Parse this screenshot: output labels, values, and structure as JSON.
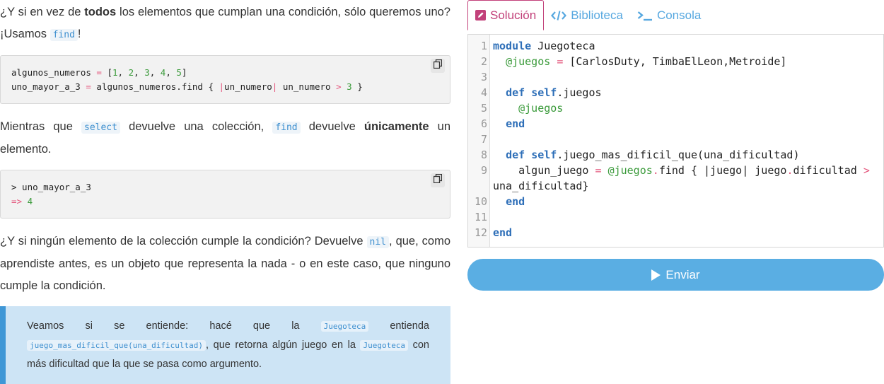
{
  "intro": {
    "p1_a": "¿Y si en vez de ",
    "p1_bold": "todos",
    "p1_b": " los elementos que cumplan una condición, sólo queremos uno? ¡Usamos ",
    "p1_code": "find",
    "p1_c": "!"
  },
  "code1": {
    "l1_a": "algunos_numeros ",
    "l1_eq": "=",
    "l1_b": " [",
    "l1_n1": "1",
    "l1_n2": "2",
    "l1_n3": "3",
    "l1_n4": "4",
    "l1_n5": "5",
    "l1_c": "]",
    "l2_a": "uno_mayor_a_3 ",
    "l2_eq": "=",
    "l2_b": " algunos_numeros.find { ",
    "l2_p1": "|",
    "l2_c": "un_numero",
    "l2_p2": "|",
    "l2_d": " un_numero ",
    "l2_gt": ">",
    "l2_n": "3",
    "l2_e": " }"
  },
  "para2": {
    "a": "Mientras que ",
    "code1": "select",
    "b": " devuelve una colección, ",
    "code2": "find",
    "c": " devuelve ",
    "bold": "únicamente",
    "d": " un elemento."
  },
  "code2": {
    "l1": "> uno_mayor_a_3",
    "l2_arrow": "=>",
    "l2_val": "4"
  },
  "para3": {
    "a": "¿Y si ningún elemento de la colección cumple la condición? Devuelve ",
    "code": "nil",
    "b": ", que, como aprendiste antes, es un objeto que representa la nada - o en este caso, que ninguno cumple la condición."
  },
  "callout": {
    "a": "Veamos si se entiende: hacé que la ",
    "code1": "Juegoteca",
    "b": " entienda ",
    "code2": "juego_mas_dificil_que(una_dificultad)",
    "c": ", que retorna algún juego en la ",
    "code3": "Juegoteca",
    "d": " con más dificultad que la que se pasa como argumento."
  },
  "tabs": {
    "solucion": "Solución",
    "biblioteca": "Biblioteca",
    "consola": "Consola"
  },
  "editor": {
    "ln": [
      "1",
      "2",
      "3",
      "4",
      "5",
      "6",
      "7",
      "8",
      "9",
      "",
      "10",
      "11",
      "12"
    ],
    "l1_kw": "module",
    "l1_rest": " Juegoteca",
    "l2_iv": "@juegos",
    "l2_eq": "=",
    "l2_rest": " [CarlosDuty, TimbaElLeon,Metroide]",
    "l4_kw1": "def",
    "l4_kw2": "self",
    "l4_rest": ".juegos",
    "l5_iv": "@juegos",
    "l6_kw": "end",
    "l8_kw1": "def",
    "l8_kw2": "self",
    "l8_rest": ".juego_mas_dificil_que(una_dificultad)",
    "l9_a": "algun_juego ",
    "l9_eq": "=",
    "l9_iv": "@juegos",
    "l9_dot": ".",
    "l9_b": "find { |juego| juego",
    "l9_dot2": ".",
    "l9_c": "dificultad ",
    "l9_gt": ">",
    "l9_wrap": "una_dificultad}",
    "l10_kw": "end",
    "l12_kw": "end"
  },
  "send": {
    "label": "Enviar"
  },
  "colors": {
    "accent_blue": "#5aaee3",
    "accent_magenta": "#c2417a",
    "callout_bg": "#cde4f5",
    "callout_border": "#3f97d6"
  }
}
